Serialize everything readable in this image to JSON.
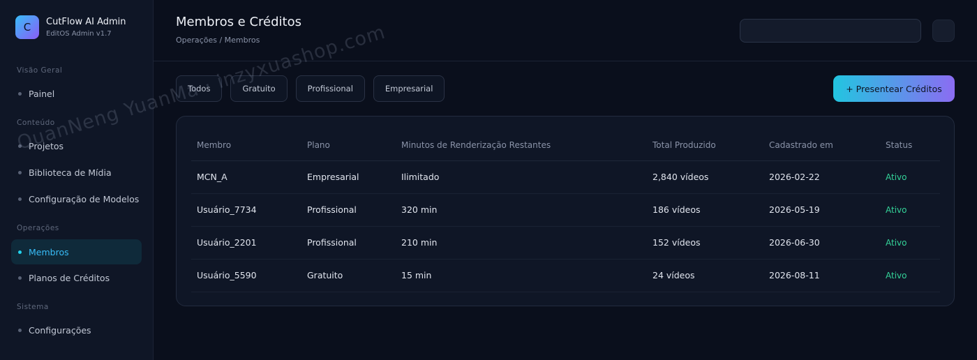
{
  "brand": {
    "logo_letter": "C",
    "title": "CutFlow AI Admin",
    "subtitle": "EditOS Admin v1.7"
  },
  "sidebar": {
    "sections": [
      {
        "label": "Visão Geral",
        "items": [
          {
            "label": "Painel",
            "active": false
          }
        ]
      },
      {
        "label": "Conteúdo",
        "items": [
          {
            "label": "Projetos",
            "active": false
          },
          {
            "label": "Biblioteca de Mídia",
            "active": false
          },
          {
            "label": "Configuração de Modelos",
            "active": false
          }
        ]
      },
      {
        "label": "Operações",
        "items": [
          {
            "label": "Membros",
            "active": true
          },
          {
            "label": "Planos de Créditos",
            "active": false
          }
        ]
      },
      {
        "label": "Sistema",
        "items": [
          {
            "label": "Configurações",
            "active": false
          }
        ]
      }
    ]
  },
  "header": {
    "title": "Membros e Créditos",
    "breadcrumb": "Operações / Membros",
    "search_value": "",
    "search_placeholder": ""
  },
  "filters": [
    "Todos",
    "Gratuito",
    "Profissional",
    "Empresarial"
  ],
  "cta_label": "+ Presentear Créditos",
  "table": {
    "columns": [
      "Membro",
      "Plano",
      "Minutos de Renderização Restantes",
      "Total Produzido",
      "Cadastrado em",
      "Status"
    ],
    "rows": [
      [
        "MCN_A",
        "Empresarial",
        "Ilimitado",
        "2,840 vídeos",
        "2026-02-22",
        "Ativo"
      ],
      [
        "Usuário_7734",
        "Profissional",
        "320 min",
        "186 vídeos",
        "2026-05-19",
        "Ativo"
      ],
      [
        "Usuário_2201",
        "Profissional",
        "210 min",
        "152 vídeos",
        "2026-06-30",
        "Ativo"
      ],
      [
        "Usuário_5590",
        "Gratuito",
        "15 min",
        "24 vídeos",
        "2026-08-11",
        "Ativo"
      ]
    ]
  },
  "watermark": "QuanNeng YuanMa · inzyxuashop.com",
  "colors": {
    "accent": "#38bdf8",
    "status_active": "#34d399",
    "background": "#0a0f1c"
  }
}
